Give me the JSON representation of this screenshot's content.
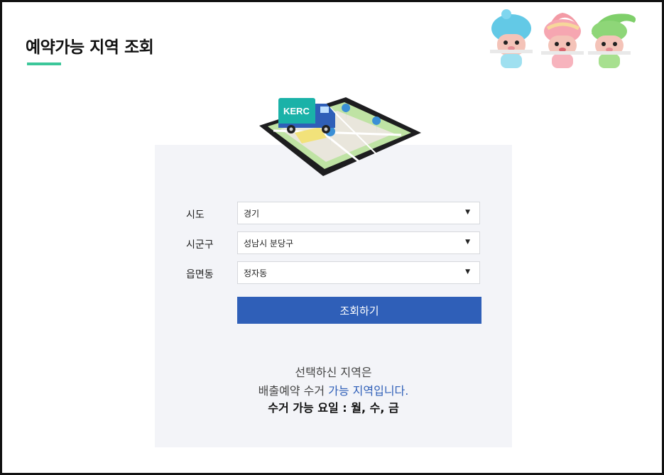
{
  "header": {
    "title": "예약가능 지역 조회"
  },
  "tablet": {
    "truck_label": "KERC"
  },
  "form": {
    "sido": {
      "label": "시도",
      "value": "경기"
    },
    "sigungu": {
      "label": "시군구",
      "value": "성남시 분당구"
    },
    "eupmyeondong": {
      "label": "읍면동",
      "value": "정자동"
    },
    "dropdown_arrow": "▼",
    "search_button": "조회하기"
  },
  "result": {
    "line1": "선택하신 지역은",
    "line2_prefix": "배출예약 수거 ",
    "line2_highlight": "가능 지역입니다.",
    "line3": "수거 가능 요일 : 월, 수, 금"
  },
  "colors": {
    "accent": "#3cc79a",
    "button": "#2f5fb8",
    "panel": "#f3f4f8"
  }
}
